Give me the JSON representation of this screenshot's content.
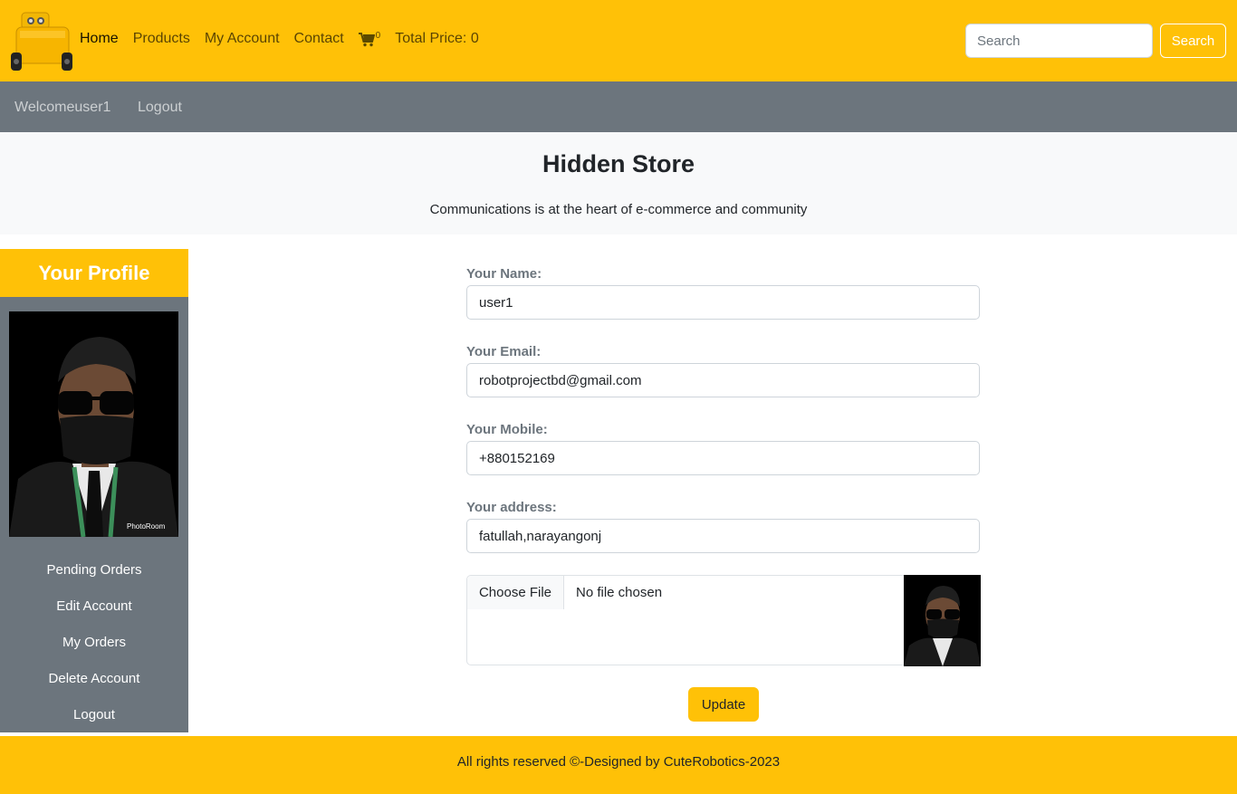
{
  "nav": {
    "links": [
      "Home",
      "Products",
      "My Account",
      "Contact"
    ],
    "cart_count": "0",
    "total_price": "Total Price: 0",
    "search_placeholder": "Search",
    "search_button": "Search"
  },
  "subnav": {
    "welcome": "Welcomeuser1",
    "logout": "Logout"
  },
  "hero": {
    "title": "Hidden Store",
    "tagline": "Communications is at the heart of e-commerce and community"
  },
  "sidebar": {
    "title": "Your Profile",
    "items": [
      "Pending Orders",
      "Edit Account",
      "My Orders",
      "Delete Account",
      "Logout"
    ]
  },
  "form": {
    "name_label": "Your Name:",
    "name_value": "user1",
    "email_label": "Your Email:",
    "email_value": "robotprojectbd@gmail.com",
    "mobile_label": "Your Mobile:",
    "mobile_value": "+880152169",
    "address_label": "Your address:",
    "address_value": "fatullah,narayangonj",
    "file_button": "Choose File",
    "file_status": "No file chosen",
    "update_button": "Update"
  },
  "footer": {
    "text": "All rights reserved ©-Designed by CuteRobotics-2023"
  },
  "colors": {
    "brand": "#ffc107",
    "secondary": "#6c757d",
    "light": "#f8f9fa"
  }
}
